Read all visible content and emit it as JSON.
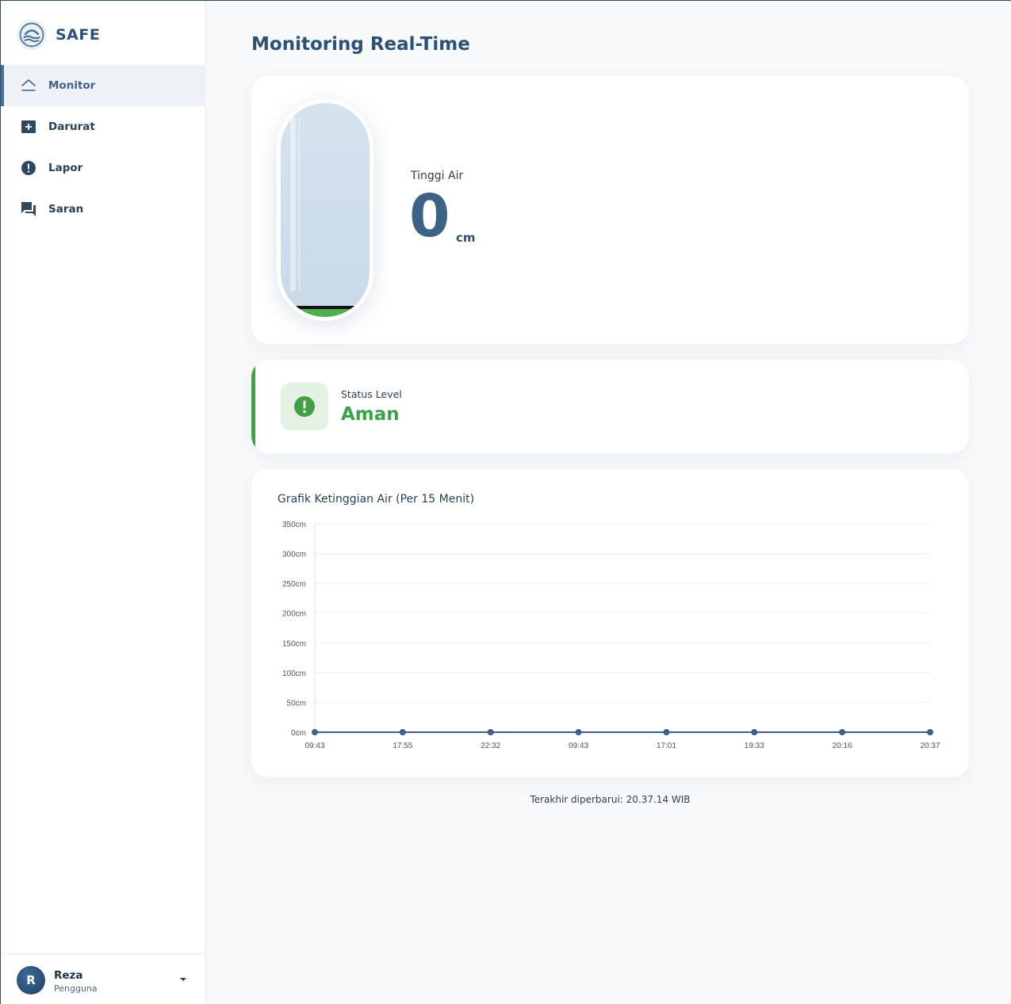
{
  "brand": {
    "name": "SAFE",
    "logo_icon": "wave-shield-icon"
  },
  "sidebar": {
    "items": [
      {
        "label": "Monitor",
        "icon": "home-chevron-icon",
        "active": true
      },
      {
        "label": "Darurat",
        "icon": "plus-box-icon",
        "active": false
      },
      {
        "label": "Lapor",
        "icon": "alert-circle-icon",
        "active": false
      },
      {
        "label": "Saran",
        "icon": "chat-bubbles-icon",
        "active": false
      }
    ]
  },
  "user": {
    "initial": "R",
    "name": "Reza",
    "role": "Pengguna"
  },
  "page": {
    "title": "Monitoring Real-Time"
  },
  "level": {
    "label": "Tinggi Air",
    "value": "0",
    "unit": "cm"
  },
  "status": {
    "label": "Status Level",
    "value": "Aman",
    "color": "#43a047"
  },
  "chart_title": "Grafik Ketinggian Air (Per 15 Menit)",
  "chart_data": {
    "type": "line",
    "categories": [
      "09:43",
      "17:55",
      "22:32",
      "09:43",
      "17:01",
      "19:33",
      "20:16",
      "20:37"
    ],
    "values": [
      0,
      0,
      0,
      0,
      0,
      0,
      0,
      0
    ],
    "ylim": [
      0,
      350
    ],
    "yticks": [
      "0cm",
      "50cm",
      "100cm",
      "150cm",
      "200cm",
      "250cm",
      "300cm",
      "350cm"
    ],
    "grid": true,
    "color": "#3d6187"
  },
  "footer": {
    "updated": "Terakhir diperbarui: 20.37.14 WIB"
  }
}
